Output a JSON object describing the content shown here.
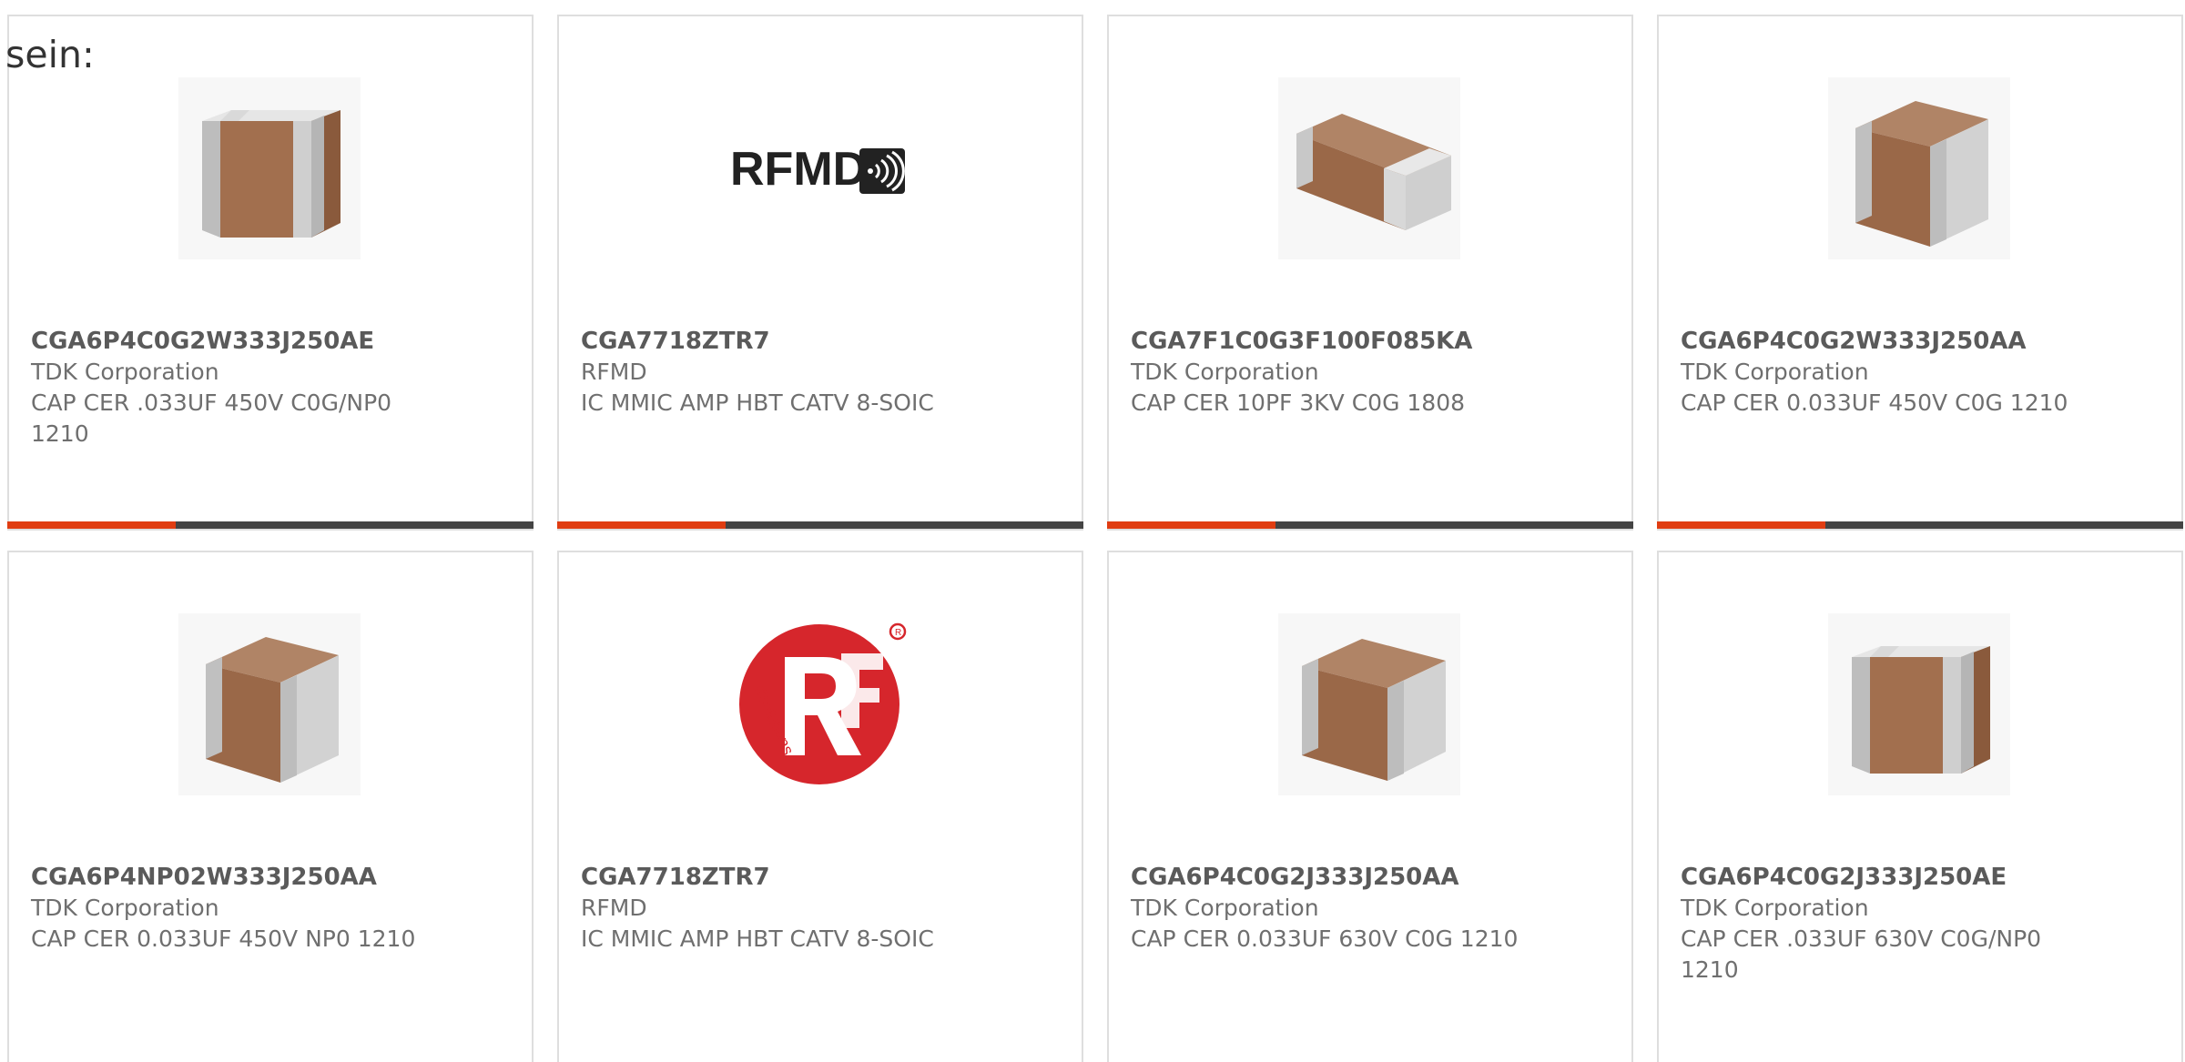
{
  "intro_text": "sein:",
  "accent_color": "#e03d12",
  "bar_color": "#444444",
  "products": [
    {
      "part_number": "CGA6P4C0G2W333J250AE",
      "manufacturer": "TDK Corporation",
      "description": "CAP CER .033UF 450V C0G/NP0 1210",
      "image": "capacitor-cube-front-icon",
      "progress_fraction": 0.32
    },
    {
      "part_number": "CGA7718ZTR7",
      "manufacturer": "RFMD",
      "description": "IC MMIC AMP HBT CATV 8-SOIC",
      "image": "rfmd-logo",
      "logo_text": "RFMD",
      "progress_fraction": 0.32
    },
    {
      "part_number": "CGA7F1C0G3F100F085KA",
      "manufacturer": "TDK Corporation",
      "description": "CAP CER 10PF 3KV C0G 1808",
      "image": "capacitor-chip-flat-icon",
      "progress_fraction": 0.32
    },
    {
      "part_number": "CGA6P4C0G2W333J250AA",
      "manufacturer": "TDK Corporation",
      "description": "CAP CER 0.033UF 450V C0G 1210",
      "image": "capacitor-cube-side-icon",
      "progress_fraction": 0.32
    },
    {
      "part_number": "CGA6P4NP02W333J250AA",
      "manufacturer": "TDK Corporation",
      "description": "CAP CER 0.033UF 450V NP0 1210",
      "image": "capacitor-cube-side-icon"
    },
    {
      "part_number": "CGA7718ZTR7",
      "manufacturer": "RFMD",
      "description": "IC MMIC AMP HBT CATV 8-SOIC",
      "image": "rf-solutions-logo",
      "logo_text": "rfsolutions"
    },
    {
      "part_number": "CGA6P4C0G2J333J250AA",
      "manufacturer": "TDK Corporation",
      "description": "CAP CER 0.033UF 630V C0G 1210",
      "image": "capacitor-cube-side-icon"
    },
    {
      "part_number": "CGA6P4C0G2J333J250AE",
      "manufacturer": "TDK Corporation",
      "description": "CAP CER .033UF 630V C0G/NP0 1210",
      "image": "capacitor-cube-front-icon"
    }
  ]
}
